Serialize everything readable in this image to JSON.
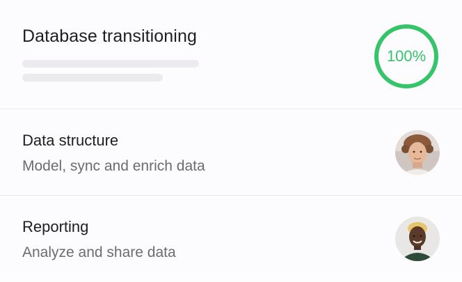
{
  "header": {
    "title": "Database transitioning",
    "progress": {
      "value": 100,
      "label": "100%",
      "color": "#35c46a"
    }
  },
  "items": [
    {
      "title": "Data structure",
      "subtitle": "Model, sync and enrich data",
      "avatar": "person-avatar-1"
    },
    {
      "title": "Reporting",
      "subtitle": "Analyze and share data",
      "avatar": "person-avatar-2"
    }
  ],
  "colors": {
    "background": "#fcfbfd",
    "divider": "#e9e8ec",
    "title_text": "#1e1e20",
    "secondary_text": "#6c6b70",
    "skeleton": "#eceaee"
  }
}
